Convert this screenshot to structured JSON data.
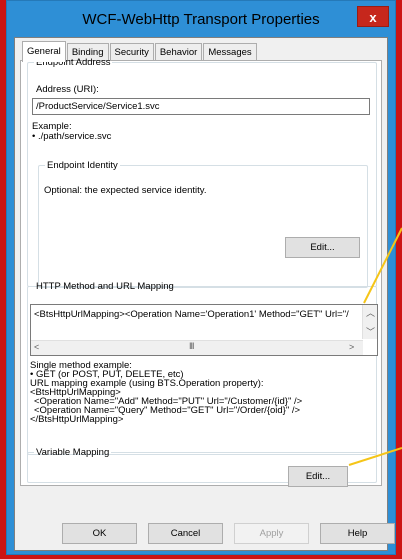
{
  "window": {
    "title": "WCF-WebHttp Transport Properties",
    "close_glyph": "x"
  },
  "tabs": [
    "General",
    "Binding",
    "Security",
    "Behavior",
    "Messages"
  ],
  "endpoint": {
    "legend": "Endpoint Address",
    "address_label": "Address (URI):",
    "address_value": "/ProductService/Service1.svc",
    "example_label": "Example:",
    "example_value": "• ./path/service.svc"
  },
  "identity": {
    "legend": "Endpoint Identity",
    "description": "Optional: the expected service identity.",
    "edit_label": "Edit..."
  },
  "http_mapping": {
    "legend": "HTTP Method and URL Mapping",
    "content": "<BtsHttpUrlMapping><Operation Name='Operation1' Method=\"GET\" Url=\"/",
    "help_lines": [
      "Single method example:",
      "• GET (or POST, PUT, DELETE, etc)",
      "URL mapping example (using BTS.Operation property):",
      "<BtsHttpUrlMapping>",
      "  <Operation Name=\"Add\" Method=\"PUT\" Url=\"/Customer/{id}\" />",
      "  <Operation Name=\"Query\" Method=\"GET\" Url=\"/Order/{oid}\" />",
      "</BtsHttpUrlMapping>"
    ]
  },
  "variable_mapping": {
    "legend": "Variable Mapping",
    "edit_label": "Edit..."
  },
  "buttons": {
    "ok": "OK",
    "cancel": "Cancel",
    "apply": "Apply",
    "help": "Help"
  },
  "colors": {
    "title_bar": "#2e8fd6",
    "close": "#c6271c",
    "annotation": "#f5c518",
    "background": "#cc1414"
  }
}
